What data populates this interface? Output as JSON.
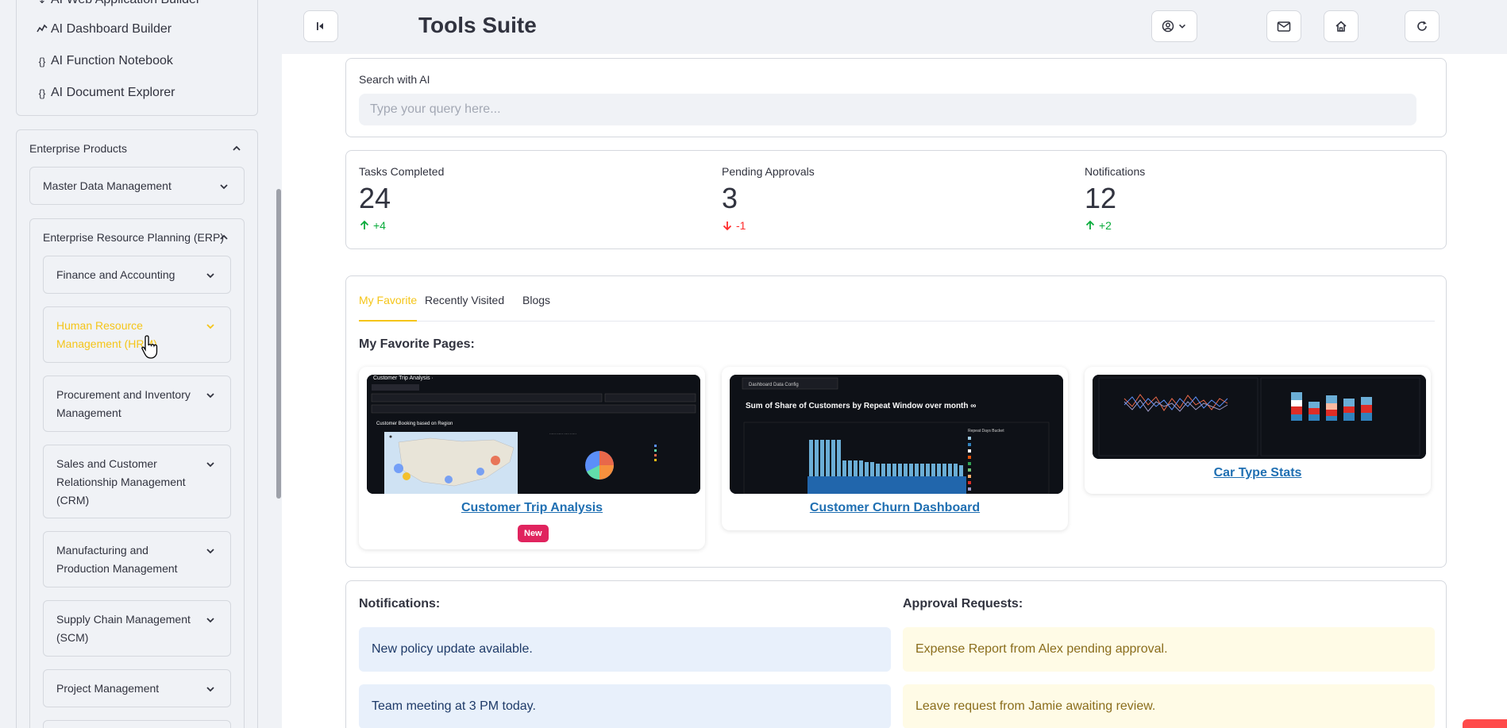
{
  "header": {
    "title": "Tools Suite"
  },
  "sidebar": {
    "top_links": [
      {
        "icon": "app-icon",
        "label": "AI Web Application Builder"
      },
      {
        "icon": "chart-line-icon",
        "label": "AI Dashboard Builder"
      },
      {
        "icon": "braces-icon",
        "label": "AI Function Notebook"
      },
      {
        "icon": "braces-icon",
        "label": "AI Document Explorer"
      }
    ],
    "enterprise": {
      "label": "Enterprise Products",
      "mdm": "Master Data Management",
      "erp": {
        "label": "Enterprise Resource Planning (ERP)",
        "items": [
          {
            "label": "Finance and Accounting"
          },
          {
            "label": "Human Resource Management (HRM)"
          },
          {
            "label": "Procurement and Inventory Management"
          },
          {
            "label": "Sales and Customer Relationship Management (CRM)"
          },
          {
            "label": "Manufacturing and Production Management"
          },
          {
            "label": "Supply Chain Management (SCM)"
          },
          {
            "label": "Project Management"
          }
        ]
      }
    }
  },
  "search": {
    "label": "Search with AI",
    "placeholder": "Type your query here..."
  },
  "metrics": [
    {
      "label": "Tasks Completed",
      "value": "24",
      "delta": "+4",
      "direction": "up"
    },
    {
      "label": "Pending Approvals",
      "value": "3",
      "delta": "-1",
      "direction": "down"
    },
    {
      "label": "Notifications",
      "value": "12",
      "delta": "+2",
      "direction": "up"
    }
  ],
  "tabs": [
    {
      "label": "My Favorite",
      "active": true
    },
    {
      "label": "Recently Visited",
      "active": false
    },
    {
      "label": "Blogs",
      "active": false
    }
  ],
  "favorites": {
    "heading": "My Favorite Pages:",
    "items": [
      {
        "title": "Customer Trip Analysis",
        "badge": "New",
        "thumb_text": "Customer Trip Analysis ·",
        "thumb_sub": "Customer Booking based on Region"
      },
      {
        "title": "Customer Churn Dashboard",
        "thumb_text": "Sum of Share of Customers by Repeat Window over month ∞",
        "thumb_sub": "Dashboard Data Config"
      },
      {
        "title": "Car Type Stats"
      }
    ]
  },
  "notifications": {
    "heading": "Notifications:",
    "items": [
      "New policy update available.",
      "Team meeting at 3 PM today."
    ]
  },
  "approvals": {
    "heading": "Approval Requests:",
    "items": [
      "Expense Report from Alex pending approval.",
      "Leave request from Jamie awaiting review."
    ]
  },
  "colors": {
    "accent": "#f5c518",
    "link": "#1f6fb2",
    "up": "#09ab3b",
    "down": "#ff2b2b"
  }
}
